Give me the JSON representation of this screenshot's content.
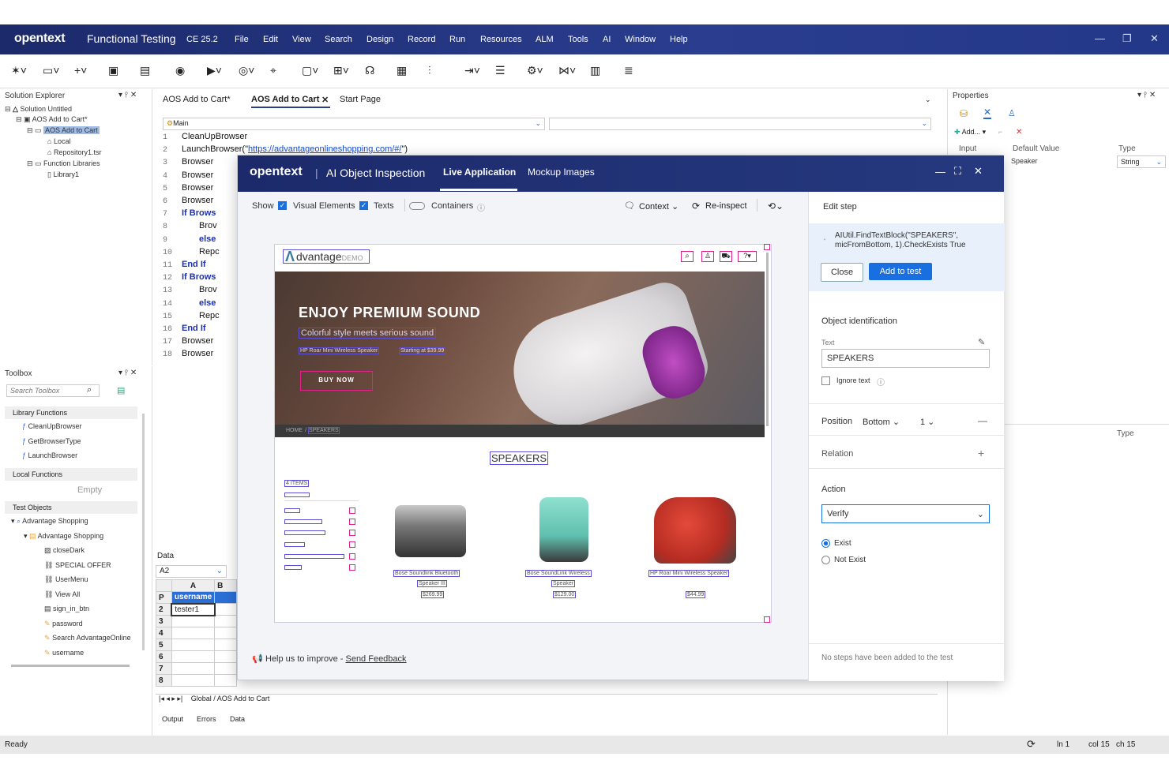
{
  "titlebar": {
    "logo": "opentext",
    "app": "Functional Testing",
    "version": "CE 25.2",
    "menu": [
      "File",
      "Edit",
      "View",
      "Search",
      "Design",
      "Record",
      "Run",
      "Resources",
      "ALM",
      "Tools",
      "AI",
      "Window",
      "Help"
    ]
  },
  "solution_explorer": {
    "title": "Solution Explorer",
    "items": [
      "Solution Untitled",
      "AOS Add to Cart*",
      "AOS Add to Cart",
      "Local",
      "Repository1.tsr",
      "Function Libraries",
      "Library1"
    ]
  },
  "toolbox": {
    "title": "Toolbox",
    "search_placeholder": "Search Toolbox",
    "library_functions_header": "Library Functions",
    "library_functions": [
      "CleanUpBrowser",
      "GetBrowserType",
      "LaunchBrowser"
    ],
    "local_functions_header": "Local Functions",
    "empty_label": "Empty",
    "test_objects_header": "Test Objects",
    "test_objects": [
      "Advantage Shopping",
      "Advantage Shopping",
      "closeDark",
      "SPECIAL OFFER",
      "UserMenu",
      "View All",
      "sign_in_btn",
      "password",
      "Search AdvantageOnline",
      "username"
    ]
  },
  "editor": {
    "tabs": [
      "AOS Add to Cart*",
      "AOS Add to Cart",
      "Start Page"
    ],
    "scope": "Main",
    "lines": [
      {
        "n": "1",
        "t": "CleanUpBrowser"
      },
      {
        "n": "2",
        "t": "LaunchBrowser(\"https://advantageonlineshopping.com/#/\")"
      },
      {
        "n": "3",
        "t": "Browser"
      },
      {
        "n": "4",
        "t": "Browser"
      },
      {
        "n": "5",
        "t": "Browser"
      },
      {
        "n": "6",
        "t": "Browser"
      },
      {
        "n": "7",
        "t": "If Brows"
      },
      {
        "n": "8",
        "t": "Brov"
      },
      {
        "n": "9",
        "t": "else"
      },
      {
        "n": "10",
        "t": "Repc"
      },
      {
        "n": "11",
        "t": "End If"
      },
      {
        "n": "12",
        "t": "If Brows"
      },
      {
        "n": "13",
        "t": "Brov"
      },
      {
        "n": "14",
        "t": "else"
      },
      {
        "n": "15",
        "t": "Repc"
      },
      {
        "n": "16",
        "t": "End If"
      },
      {
        "n": "17",
        "t": "Browser"
      },
      {
        "n": "18",
        "t": "Browser"
      }
    ]
  },
  "data_panel": {
    "title": "Data",
    "cell_ref": "A2",
    "col_a": "A",
    "col_b": "B",
    "header_row": "P",
    "header_value": "username",
    "row2_value": "tester1",
    "rows": [
      "2",
      "3",
      "4",
      "5",
      "6",
      "7",
      "8"
    ],
    "sheet_tabs": [
      "Global",
      "AOS Add to Cart"
    ]
  },
  "bottom_tabs": [
    "Output",
    "Errors",
    "Data"
  ],
  "properties": {
    "title": "Properties",
    "add_label": "Add...",
    "col_input": "Input",
    "col_default": "Default Value",
    "col_type": "Type",
    "row_default": "Speaker",
    "row_type": "String",
    "lower_col_type": "Type"
  },
  "status": {
    "ready": "Ready",
    "ln": "ln 1",
    "col": "col 15",
    "ch": "ch 15"
  },
  "dialog": {
    "logo": "opentext",
    "title": "AI Object Inspection",
    "tab_live": "Live Application",
    "tab_mockup": "Mockup Images",
    "show": "Show",
    "visual_elements": "Visual Elements",
    "texts": "Texts",
    "containers": "Containers",
    "context": "Context",
    "reinspect": "Re-inspect",
    "help_text": "Help us to improve - ",
    "feedback": "Send Feedback",
    "aut": {
      "logo": "dvantage",
      "logo_suffix": "DEMO",
      "hero_title": "ENJOY PREMIUM SOUND",
      "hero_sub": "Colorful style meets serious sound",
      "hero_small1": "HP Roar Mini Wireless Speaker",
      "hero_small2": "Starting at $39.99",
      "buy_now": "BUY NOW",
      "crumb_home": "HOME",
      "crumb_current": "SPEAKERS",
      "category": "SPEAKERS",
      "items_label": "4 ITEMS",
      "products": [
        {
          "name1": "Bose Soundlink Bluetooth",
          "name2": "Speaker III",
          "price": "$269.99"
        },
        {
          "name1": "Bose SoundLink Wireless",
          "name2": "Speaker",
          "price": "$129.00"
        },
        {
          "name1": "HP Roar Mini Wireless Speaker",
          "name2": "",
          "price": "$44.99"
        }
      ]
    },
    "edit_step": "Edit step",
    "step_code": "AIUtil.FindTextBlock(\"SPEAKERS\", micFromBottom, 1).CheckExists True",
    "close": "Close",
    "add_to_test": "Add to test",
    "object_identification": "Object identification",
    "text_label": "Text",
    "text_value": "SPEAKERS",
    "ignore_text": "Ignore text",
    "position": "Position",
    "position_value": "Bottom",
    "position_index": "1",
    "relation": "Relation",
    "action": "Action",
    "action_value": "Verify",
    "exist": "Exist",
    "not_exist": "Not Exist",
    "no_steps": "No steps have been added to the test"
  }
}
